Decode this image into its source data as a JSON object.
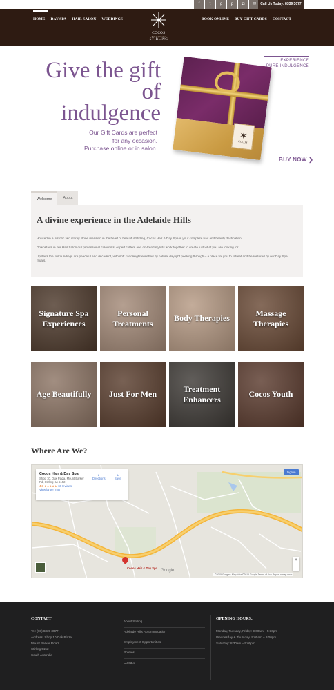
{
  "topbar": {
    "social_icons": [
      "facebook-icon",
      "twitter-icon",
      "google-plus-icon",
      "pinterest-icon",
      "instagram-icon",
      "email-icon"
    ],
    "social_glyphs": [
      "f",
      "t",
      "g",
      "p",
      "◘",
      "✉"
    ],
    "phone": "Call Us Today: 8339 3077"
  },
  "nav": {
    "left": [
      "HOME",
      "DAY SPA",
      "HAIR SALON",
      "WEDDINGS"
    ],
    "right": [
      "BOOK ONLINE",
      "BUY GIFT CARDS",
      "CONTACT"
    ],
    "logo_name": "COCOS",
    "logo_sub": "Hair & Day Spa",
    "logo_place": "STIRLING"
  },
  "hero": {
    "title": "Give the gift of indulgence",
    "subtitle_lines": [
      "Our Gift Cards are perfect",
      "for any occasion.",
      "Purchase online or in salon."
    ],
    "tagline_lines": [
      "EXPERIENCE",
      "PURE INDULGENCE"
    ],
    "buy_now": "BUY NOW ❯",
    "card_label": "COCOS"
  },
  "tabs": [
    "Welcome",
    "About"
  ],
  "welcome": {
    "heading": "A divine experience in the Adelaide Hills",
    "paragraphs": [
      "Housed in a historic two storey stone mansion in the heart of beautiful Stirling, Cocos Hair & Day Spa is your complete hair and beauty destination.",
      "Downstairs in our Hair Salon our professional colourists, expert cutters and on-trend stylists work together to create just what you are looking for.",
      "Upstairs the surroundings are peaceful and decadent, with soft candlelight enriched by natural daylight peeking through – a place for you to retreat and be restored by our Day Spa rituals."
    ]
  },
  "tiles": [
    {
      "label": "Signature Spa Experiences",
      "bg": "#4e3a2c"
    },
    {
      "label": "Personal Treatments",
      "bg": "#a48a78"
    },
    {
      "label": "Body Therapies",
      "bg": "#b69a84"
    },
    {
      "label": "Massage Therapies",
      "bg": "#6a4a36"
    },
    {
      "label": "Age Beautifully",
      "bg": "#8d7565"
    },
    {
      "label": "Just For Men",
      "bg": "#5a3e2e"
    },
    {
      "label": "Treatment Enhancers",
      "bg": "#3e3a36"
    },
    {
      "label": "Cocos Youth",
      "bg": "#5b3b2e"
    }
  ],
  "map": {
    "heading": "Where Are We?",
    "place_name": "Cocos Hair & Day Spa",
    "place_address": "Shop 10, Oak Plaza, Mount Barker Rd, Stirling SA 5152",
    "rating": "4.3 ★★★★★",
    "reviews": "13 reviews",
    "larger_map": "View larger map",
    "directions": "Directions",
    "save": "Save",
    "sign_in": "Sign in",
    "marker_label": "Cocos Hair & Day Spa",
    "google": "Google",
    "attribution": "©2015 Google · Map data ©2015 Google   Terms of Use   Report a map error",
    "zoom_in": "+",
    "zoom_out": "−"
  },
  "footer": {
    "contact_title": "CONTACT",
    "contact_lines": [
      "Tel: (08) 8339 3077",
      "Address: Shop 10 Oak Plaza",
      "Mount Barker Road",
      "Stirling 5152",
      "South Australia"
    ],
    "links": [
      "About Stirling",
      "Adelaide Hills Accommodation",
      "Employment Opportunities",
      "Policies",
      "Contact"
    ],
    "hours_title": "OPENING HOURS:",
    "hours_lines": [
      "Monday, Tuesday, Friday: 9:00am – 5:30pm",
      "Wednesday & Thursday: 9:00am – 9:00pm",
      "Saturday: 8:30am – 5:00pm"
    ]
  }
}
